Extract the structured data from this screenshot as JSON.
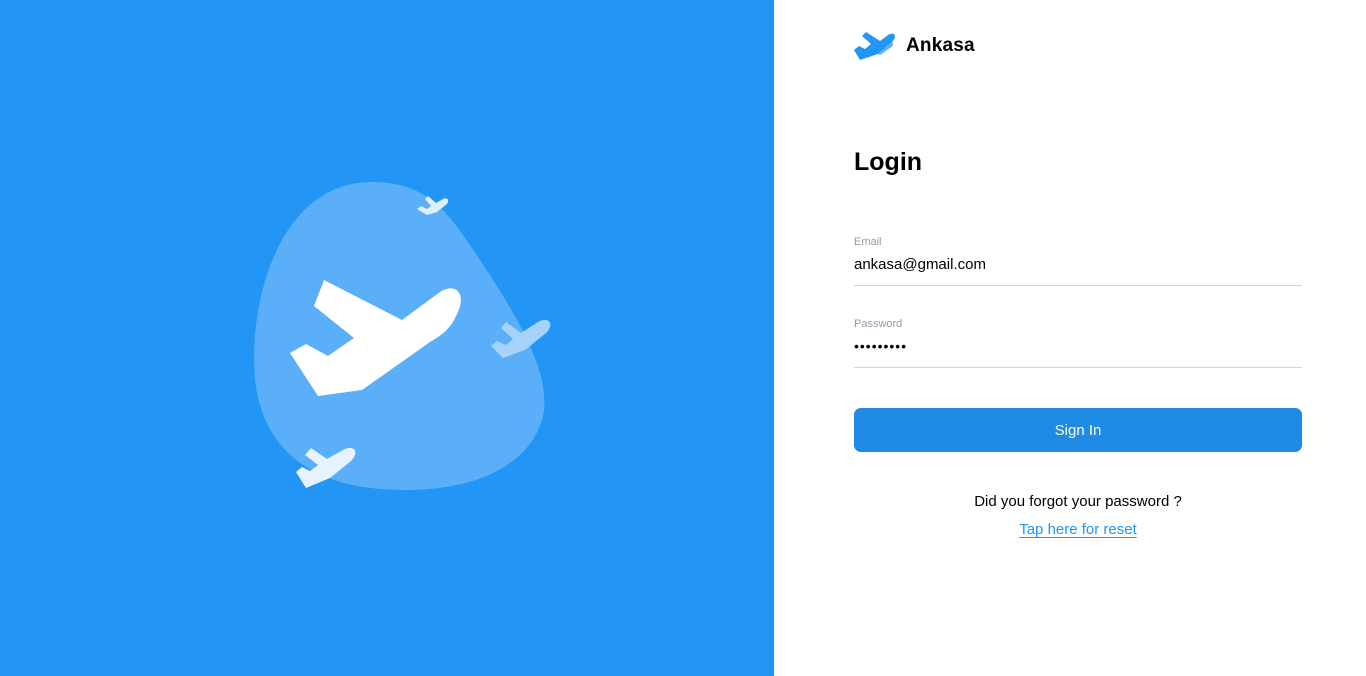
{
  "colors": {
    "left_panel_background": "#2395F5",
    "blob": "#5AAFF8",
    "accent": "#1E8AE4",
    "divider": "#D2D2D2"
  },
  "brand": {
    "name": "Ankasa",
    "icon": "airplane-icon"
  },
  "illustration": {
    "main_icon": "airplane-icon",
    "small_icons": [
      "airplane-icon",
      "airplane-icon",
      "airplane-icon"
    ]
  },
  "login": {
    "title": "Login",
    "email": {
      "label": "Email",
      "value": "ankasa@gmail.com"
    },
    "password": {
      "label": "Password",
      "value": "•••••••••"
    },
    "signin_label": "Sign In",
    "forgot_text": "Did you forgot your password ?",
    "reset_link": "Tap here for reset"
  }
}
